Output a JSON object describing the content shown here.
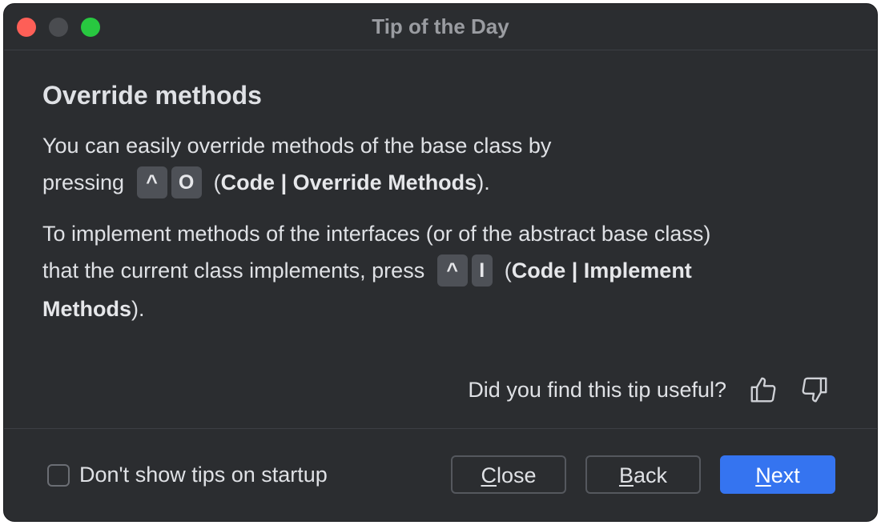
{
  "window": {
    "title": "Tip of the Day"
  },
  "tip": {
    "title": "Override methods",
    "para1": {
      "line1": "You can easily override methods of the base class by",
      "line2_prefix": "pressing",
      "keys": [
        "^",
        "O"
      ],
      "open_paren": "(",
      "menu_path": "Code | Override Methods",
      "close": ")."
    },
    "para2": {
      "line1": "To implement methods of the interfaces (or of the abstract base class)",
      "line2_prefix": "that the current class implements, press",
      "keys": [
        "^",
        "I"
      ],
      "open_paren": "(",
      "menu_path_part1": "Code | Implement",
      "menu_path_part2": "Methods",
      "close": ")."
    }
  },
  "feedback": {
    "question": "Did you find this tip useful?",
    "thumbs_up_icon": "thumbs-up-icon",
    "thumbs_down_icon": "thumbs-down-icon"
  },
  "footer": {
    "checkbox_label": "Don't show tips on startup",
    "checkbox_checked": false,
    "buttons": {
      "close": {
        "mnemonic": "C",
        "rest": "lose"
      },
      "back": {
        "mnemonic": "B",
        "rest": "ack"
      },
      "next": {
        "mnemonic": "N",
        "rest": "ext"
      }
    }
  },
  "colors": {
    "background": "#2b2d30",
    "text": "#dfe1e5",
    "primary_button": "#3574f0",
    "key_cap": "#4e5157",
    "traffic_close": "#fe5f57",
    "traffic_minimize": "#4a4c50",
    "traffic_maximize": "#28c840"
  }
}
